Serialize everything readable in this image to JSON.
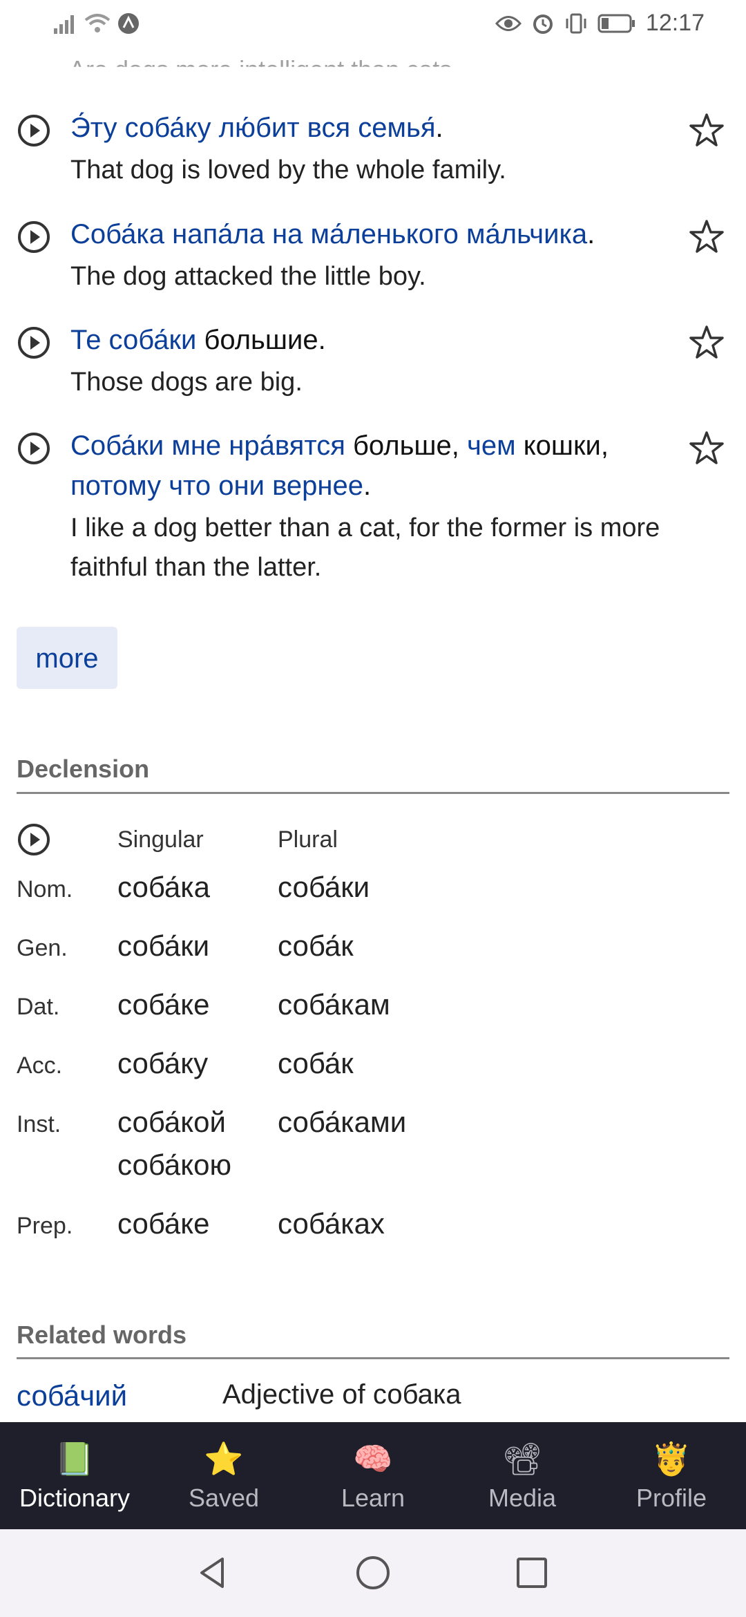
{
  "status_bar": {
    "time": "12:17"
  },
  "partial_line": "Are dogs more intelligent than cats.",
  "examples": [
    {
      "ru_parts": [
        {
          "text": "Э́ту соба́ку лю́бит вся семья́",
          "link": true
        },
        {
          "text": ".",
          "link": false
        }
      ],
      "en": "That dog is loved by the whole family."
    },
    {
      "ru_parts": [
        {
          "text": "Соба́ка напа́ла на ма́ленького ма́льчика",
          "link": true
        },
        {
          "text": ".",
          "link": false
        }
      ],
      "en": "The dog attacked the little boy."
    },
    {
      "ru_parts": [
        {
          "text": "Те соба́ки",
          "link": true
        },
        {
          "text": " большие.",
          "link": false
        }
      ],
      "en": "Those dogs are big."
    },
    {
      "ru_parts": [
        {
          "text": "Соба́ки мне нра́вятся",
          "link": true
        },
        {
          "text": " больше, ",
          "link": false
        },
        {
          "text": "чем",
          "link": true
        },
        {
          "text": " кошки, ",
          "link": false
        },
        {
          "text": "потому что они вернее",
          "link": true
        },
        {
          "text": ".",
          "link": false
        }
      ],
      "en": "I like a dog better than a cat, for the former is more faithful than the latter."
    }
  ],
  "more_label": "more",
  "declension": {
    "title": "Declension",
    "headers": {
      "singular": "Singular",
      "plural": "Plural"
    },
    "rows": [
      {
        "case": "Nom.",
        "singular": [
          "соба́ка"
        ],
        "plural": [
          "соба́ки"
        ]
      },
      {
        "case": "Gen.",
        "singular": [
          "соба́ки"
        ],
        "plural": [
          "соба́к"
        ]
      },
      {
        "case": "Dat.",
        "singular": [
          "соба́ке"
        ],
        "plural": [
          "соба́кам"
        ]
      },
      {
        "case": "Acc.",
        "singular": [
          "соба́ку"
        ],
        "plural": [
          "соба́к"
        ]
      },
      {
        "case": "Inst.",
        "singular": [
          "соба́кой",
          "соба́кою"
        ],
        "plural": [
          "соба́ками"
        ]
      },
      {
        "case": "Prep.",
        "singular": [
          "соба́ке"
        ],
        "plural": [
          "соба́ках"
        ]
      }
    ]
  },
  "related": {
    "title": "Related words",
    "items": [
      {
        "word": "соба́чий",
        "definition": "Adjective of собака"
      }
    ]
  },
  "bottom_nav": [
    {
      "label": "Dictionary",
      "emoji": "📗",
      "icon": "book-icon",
      "active": true
    },
    {
      "label": "Saved",
      "emoji": "⭐",
      "icon": "star-icon",
      "active": false
    },
    {
      "label": "Learn",
      "emoji": "🧠",
      "icon": "brain-icon",
      "active": false
    },
    {
      "label": "Media",
      "emoji": "📽",
      "icon": "projector-icon",
      "active": false
    },
    {
      "label": "Profile",
      "emoji": "🤴",
      "icon": "prince-icon",
      "active": false
    }
  ],
  "colors": {
    "link": "#0b3f99",
    "nav_bg": "#1f1f2b",
    "more_bg": "#e6ebf7"
  }
}
